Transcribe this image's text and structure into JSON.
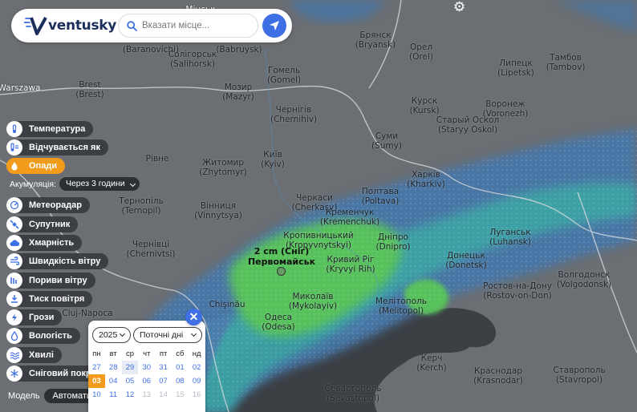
{
  "header": {
    "logo_text": "ventusky",
    "search_placeholder": "Вказати місце..."
  },
  "icons": {
    "logo": "ventusky-v-logo-icon",
    "search": "search-icon",
    "locate": "location-arrow-icon",
    "settings": "gear-icon",
    "close": "close-icon"
  },
  "layers": [
    {
      "label": "Температура",
      "icon": "thermometer-icon"
    },
    {
      "label": "Відчувається як",
      "icon": "feels-like-icon"
    },
    {
      "label": "Опади",
      "icon": "raindrop-icon",
      "active": true
    },
    {
      "label": "Метеорадар",
      "icon": "radar-icon"
    },
    {
      "label": "Супутник",
      "icon": "satellite-icon"
    },
    {
      "label": "Хмарність",
      "icon": "cloud-icon"
    },
    {
      "label": "Швидкість вітру",
      "icon": "wind-icon"
    },
    {
      "label": "Пориви вітру",
      "icon": "gusts-icon"
    },
    {
      "label": "Тиск повітря",
      "icon": "pressure-icon"
    },
    {
      "label": "Грози",
      "icon": "lightning-icon"
    },
    {
      "label": "Вологість",
      "icon": "humidity-icon"
    },
    {
      "label": "Хвилі",
      "icon": "waves-icon"
    },
    {
      "label": "Сніговий покрив",
      "icon": "snowflake-icon"
    }
  ],
  "accumulation": {
    "label": "Акумуляція:",
    "value": "Через 3 години"
  },
  "model": {
    "label": "Модель",
    "value": "Автоматично"
  },
  "snow_point": {
    "amount": "2 cm (Сніг)",
    "city": "Первомайськ"
  },
  "calendar": {
    "year": "2025",
    "range": "Поточні дні",
    "weekdays": [
      "пн",
      "вт",
      "ср",
      "чт",
      "пт",
      "сб",
      "нд"
    ],
    "weeks": [
      [
        "27",
        "28",
        "29",
        "30",
        "31",
        "01",
        "02"
      ],
      [
        "03",
        "04",
        "05",
        "06",
        "07",
        "08",
        "09"
      ],
      [
        "10",
        "11",
        "12",
        "13",
        "14",
        "15",
        "16"
      ]
    ],
    "today": "03"
  },
  "map_colors": {
    "land": "#6b6e72",
    "sea": "#3c3f44",
    "precip_light": "#4b7fb0",
    "precip_medium": "#3aa3a8",
    "precip_heavy": "#56c65a"
  },
  "cities": [
    {
      "name": "Warszawa",
      "sub": ""
    },
    {
      "name": "Brest",
      "sub": "(Brest)"
    },
    {
      "name": "Солігорськ",
      "sub": "(Salihorsk)"
    },
    {
      "name": "(Baranovichi)",
      "sub": ""
    },
    {
      "name": "(Babruysk)",
      "sub": ""
    },
    {
      "name": "Мозир",
      "sub": "(Mazyr)"
    },
    {
      "name": "Гомель",
      "sub": "(Gomel)"
    },
    {
      "name": "Брянск",
      "sub": "(Bryansk)"
    },
    {
      "name": "Орел",
      "sub": "(Orel)"
    },
    {
      "name": "Липецк",
      "sub": "(Lipetsk)"
    },
    {
      "name": "Тамбов",
      "sub": "(Tambov)"
    },
    {
      "name": "Курск",
      "sub": "(Kursk)"
    },
    {
      "name": "Старый Оскол",
      "sub": "(Staryy Oskol)"
    },
    {
      "name": "Воронеж",
      "sub": "(Voronezh)"
    },
    {
      "name": "Чернігів",
      "sub": "(Chernihiv)"
    },
    {
      "name": "Суми",
      "sub": "(Sumy)"
    },
    {
      "name": "Київ",
      "sub": "(Kyiv)"
    },
    {
      "name": "Житомир",
      "sub": "(Zhytomyr)"
    },
    {
      "name": "Рівне",
      "sub": ""
    },
    {
      "name": "Тернопіль",
      "sub": "(Ternopil)"
    },
    {
      "name": "Вінниця",
      "sub": "(Vinnytsya)"
    },
    {
      "name": "Черкаси",
      "sub": "(Cherkasy)"
    },
    {
      "name": "Кременчук",
      "sub": "(Kremenchuk)"
    },
    {
      "name": "Полтава",
      "sub": "(Poltava)"
    },
    {
      "name": "Харків",
      "sub": "(Kharkiv)"
    },
    {
      "name": "Луганськ",
      "sub": "(Luhansk)"
    },
    {
      "name": "Донецьк",
      "sub": "(Donetsk)"
    },
    {
      "name": "Волгодонск",
      "sub": "(Volgodonsk)"
    },
    {
      "name": "Ростов-на-Дону",
      "sub": "(Rostov-on-Don)"
    },
    {
      "name": "Дніпро",
      "sub": "(Dnipro)"
    },
    {
      "name": "Кропивницький",
      "sub": "(Kropyvnytskyi)"
    },
    {
      "name": "Кривий Ріг",
      "sub": "(Kryvyi Rih)"
    },
    {
      "name": "Чернівці",
      "sub": "(Chernivtsi)"
    },
    {
      "name": "Chişinău",
      "sub": ""
    },
    {
      "name": "Cluj-Napoca",
      "sub": ""
    },
    {
      "name": "Миколаїв",
      "sub": "(Mykolayiv)"
    },
    {
      "name": "Одеса",
      "sub": "(Odesa)"
    },
    {
      "name": "Мелітополь",
      "sub": "(Melitopol)"
    },
    {
      "name": "Керч",
      "sub": "(Kerch)"
    },
    {
      "name": "Краснодар",
      "sub": "(Krasnodar)"
    },
    {
      "name": "Ставрополь",
      "sub": "(Stavropol)"
    },
    {
      "name": "Севастополь",
      "sub": "(Sevastopol)"
    },
    {
      "name": "Мінськ",
      "sub": ""
    }
  ]
}
